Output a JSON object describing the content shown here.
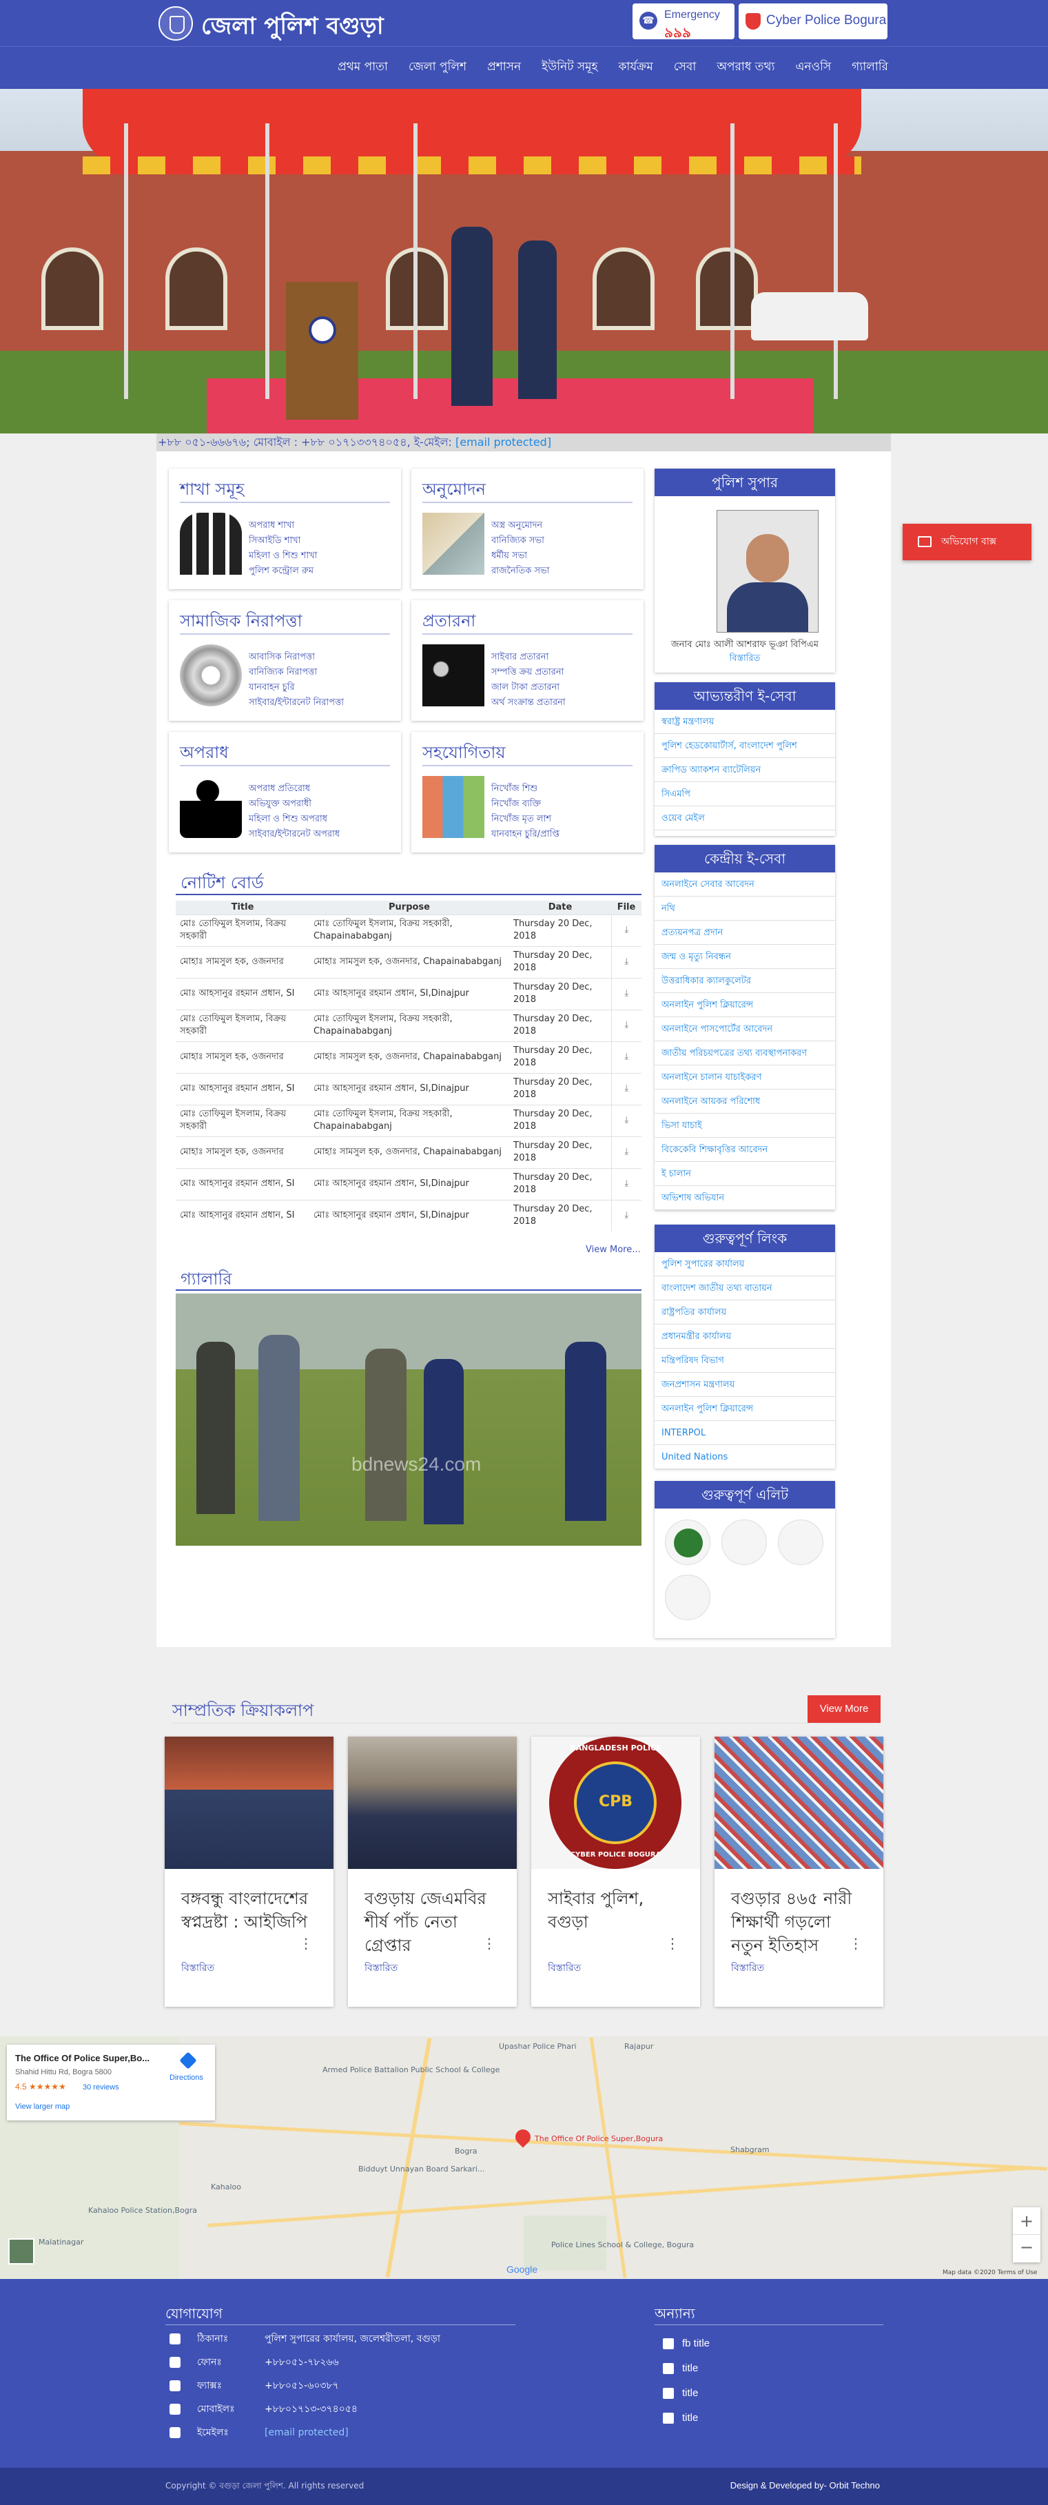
{
  "header": {
    "title": "জেলা পুলিশ বগুড়া",
    "emergency_label": "Emergency",
    "emergency_number": "৯৯৯",
    "cyber_label": "Cyber Police Bogura"
  },
  "nav": [
    "প্রথম পাতা",
    "জেলা পুলিশ",
    "প্রশাসন",
    "ইউনিট সমূহ",
    "কার্যক্রম",
    "সেবা",
    "অপরাধ তথ্য",
    "এনওসি",
    "গ্যালারি"
  ],
  "ticker": {
    "text": "+৮৮ ০৫১-৬৬৬৭৬; মোবাইল : +৮৮ ০১৭১৩৩৭৪০৫৪, ই-মেইল: ",
    "email": "[email protected]"
  },
  "categories": [
    {
      "title": "শাখা সমূহ",
      "items": [
        "অপরাধ শাখা",
        "সিআইডি শাখা",
        "মহিলা ও শিশু শাখা",
        "পুলিশ কন্ট্রোল রুম"
      ]
    },
    {
      "title": "অনুমোদন",
      "items": [
        "অস্ত্র অনুমোদন",
        "বানিজ্যিক সভা",
        "ধর্মীয় সভা",
        "রাজনৈতিক সভা"
      ]
    },
    {
      "title": "সামাজিক নিরাপত্তা",
      "items": [
        "আবাসিক নিরাপত্তা",
        "বানিজ্যিক নিরাপত্তা",
        "যানবাহন চুরি",
        "সাইবার/ইন্টারনেট নিরাপত্তা"
      ]
    },
    {
      "title": "প্রতারনা",
      "items": [
        "সাইবার প্রতারনা",
        "সম্পত্তি ক্রয় প্রতারনা",
        "জাল টাকা প্রতারনা",
        "অর্থ সংক্রান্ত প্রতারনা"
      ]
    },
    {
      "title": "অপরাধ",
      "items": [
        "অপরাধ প্রতিরোধ",
        "অভিযুক্ত অপরাধী",
        "মহিলা ও শিশু অপরাধ",
        "সাইবার/ইন্টারনেট অপরাধ"
      ]
    },
    {
      "title": "সহযোগিতায়",
      "items": [
        "নিখোঁজ শিশু",
        "নিখোঁজ ব্যক্তি",
        "নিখোঁজ মৃত লাশ",
        "যানবাহন চুরি/প্রাপ্তি"
      ]
    }
  ],
  "notice": {
    "title": "নোটিশ বোর্ড",
    "columns": [
      "Title",
      "Purpose",
      "Date",
      "File"
    ],
    "rows": [
      [
        "মোঃ তোফিমুল ইসলাম, বিক্রয় সহকারী",
        "মোঃ তোফিমুল ইসলাম, বিক্রয় সহকারী, Chapainababganj",
        "Thursday 20 Dec, 2018"
      ],
      [
        "মোহাঃ সামসুল হক, ওজনদার",
        "মোহাঃ সামসুল হক, ওজনদার, Chapainababganj",
        "Thursday 20 Dec, 2018"
      ],
      [
        "মোঃ আহসানুর রহমান প্রধান, SI",
        "মোঃ আহসানুর রহমান প্রধান, SI,Dinajpur",
        "Thursday 20 Dec, 2018"
      ],
      [
        "মোঃ তোফিমুল ইসলাম, বিক্রয় সহকারী",
        "মোঃ তোফিমুল ইসলাম, বিক্রয় সহকারী, Chapainababganj",
        "Thursday 20 Dec, 2018"
      ],
      [
        "মোহাঃ সামসুল হক, ওজনদার",
        "মোহাঃ সামসুল হক, ওজনদার, Chapainababganj",
        "Thursday 20 Dec, 2018"
      ],
      [
        "মোঃ আহসানুর রহমান প্রধান, SI",
        "মোঃ আহসানুর রহমান প্রধান, SI,Dinajpur",
        "Thursday 20 Dec, 2018"
      ],
      [
        "মোঃ তোফিমুল ইসলাম, বিক্রয় সহকারী",
        "মোঃ তোফিমুল ইসলাম, বিক্রয় সহকারী, Chapainababganj",
        "Thursday 20 Dec, 2018"
      ],
      [
        "মোহাঃ সামসুল হক, ওজনদার",
        "মোহাঃ সামসুল হক, ওজনদার, Chapainababganj",
        "Thursday 20 Dec, 2018"
      ],
      [
        "মোঃ আহসানুর রহমান প্রধান, SI",
        "মোঃ আহসানুর রহমান প্রধান, SI,Dinajpur",
        "Thursday 20 Dec, 2018"
      ],
      [
        "মোঃ আহসানুর রহমান প্রধান, SI",
        "মোঃ আহসানুর রহমান প্রধান, SI,Dinajpur",
        "Thursday 20 Dec, 2018"
      ]
    ],
    "view_more": "View More..."
  },
  "gallery": {
    "title": "গ্যালারি",
    "watermark": "bdnews24.com"
  },
  "sidebar": {
    "sp_title": "পুলিশ সুপার",
    "sp_name": "জনাব মোঃ আলী আশরাফ ভূঞা বিপিএম",
    "sp_details": "বিস্তারিত",
    "internal_title": "আভ্যন্তরীণ ই-সেবা",
    "internal_items": [
      "স্বরাষ্ট্র মন্ত্রণালয়",
      "পুলিশ হেডকোয়ার্টার্স, বাংলাদেশ পুলিশ",
      "ক্রাপিড অ্যাকশন ব্যাটেলিয়ন",
      "সিএমপি",
      "ওয়েব মেইল"
    ],
    "central_title": "কেন্দ্রীয় ই-সেবা",
    "central_items": [
      "অনলাইনে সেবার আবেদন",
      "নথি",
      "প্রত্যয়নপত্র প্রদান",
      "জন্ম ও মৃত্যু নিবন্ধন",
      "উত্তরাধিকার ক্যালকুলেটর",
      "অনলাইন পুলিশ ক্লিয়ারেন্স",
      "অনলাইনে পাসপোর্টের আবেদন",
      "জাতীয় পরিচয়পত্রের তথ্য ব্যবস্থাপনাকরণ",
      "অনলাইনে চালান যাচাইকরণ",
      "অনলাইনে আয়কর পরিশোধ",
      "ভিসা যাচাই",
      "বিকেকেবি শিক্ষাবৃত্তির আবেদন",
      "ই চালান",
      "অভিশাষ অভিযান"
    ],
    "links_title": "গুরুত্বপূর্ণ লিংক",
    "links_items": [
      "পুলিশ সুপারের কার্যালয়",
      "বাংলাদেশ জাতীয় তথ্য বাতায়ন",
      "রাষ্ট্রপতির কার্যালয়",
      "প্রধানমন্ত্রীর কার্যালয়",
      "মন্ত্রিপরিষদ বিভাগ",
      "জনপ্রশাসন মন্ত্রণালয়",
      "অনলাইন পুলিশ ক্লিয়ারেন্স",
      "INTERPOL",
      "United Nations"
    ],
    "elite_title": "গুরুত্বপূর্ণ এলিট"
  },
  "complaint_label": "অভিযোগ বাক্স",
  "activities": {
    "title": "সাম্প্রতিক ক্রিয়াকলাপ",
    "more": "View More",
    "cards": [
      {
        "title": "বঙ্গবন্ধু বাংলাদেশের স্বপ্নদ্রষ্টা : আইজিপি",
        "link": "বিস্তারিত"
      },
      {
        "title": "বগুড়ায় জেএমবির শীর্ষ পাঁচ নেতা গ্রেপ্তার",
        "link": "বিস্তারিত"
      },
      {
        "title": "সাইবার পুলিশ, বগুড়া",
        "link": "বিস্তারিত"
      },
      {
        "title": "বগুড়ার ৪৬৫ নারী শিক্ষার্থী গড়লো নতুন ইতিহাস",
        "link": "বিস্তারিত"
      }
    ],
    "cpb_top": "BANGLADESH POLICE",
    "cpb_mid": "CPB",
    "cpb_bottom": "CYBER POLICE BOGURA"
  },
  "map": {
    "place_name": "The Office Of Police Super,Bo...",
    "address": "Shahid Hittu Rd, Bogra 5800",
    "rating": "4.5",
    "stars": "★★★★★",
    "reviews": "30 reviews",
    "larger": "View larger map",
    "directions": "Directions",
    "pin_label": "The Office Of Police Super,Bogura",
    "labels": [
      "Upashar Police Phari",
      "Armed Police Battalion Public School & College",
      "Bidduyt Unnayan Board Sarkari...",
      "Kahaloo Police Station,Bogra",
      "Police Lines School & College, Bogura",
      "Shabgram",
      "Rajapur",
      "Bogra",
      "Kahaloo",
      "Malatinagar"
    ],
    "attribution": "Map data ©2020   Terms of Use",
    "google": "Google"
  },
  "footer": {
    "contact_title": "যোগাযোগ",
    "contact": [
      {
        "k": "ঠিকানাঃ",
        "v": "পুলিশ সুপারের কার্যালয়, জলেশ্বরীতলা, বগুড়া"
      },
      {
        "k": "ফোনঃ",
        "v": "+৮৮০৫১-৭৮২৬৬"
      },
      {
        "k": "ফ্যাক্সঃ",
        "v": "+৮৮০৫১-৬০৩৮৭"
      },
      {
        "k": "মোবাইলঃ",
        "v": "+৮৮০১৭১৩-৩৭৪০৫৪"
      },
      {
        "k": "ইমেইলঃ",
        "v": "[email protected]"
      }
    ],
    "other_title": "অন্যান্য",
    "other": [
      "fb title",
      "title",
      "title",
      "title"
    ],
    "copyright": "Copyright © বগুড়া জেলা পুলিশ. All rights reserved",
    "developer": "Design & Developed by- Orbit Techno"
  },
  "colors": {
    "brand": "#3f51b5",
    "accent": "#e53935",
    "link": "#1e88e5"
  }
}
